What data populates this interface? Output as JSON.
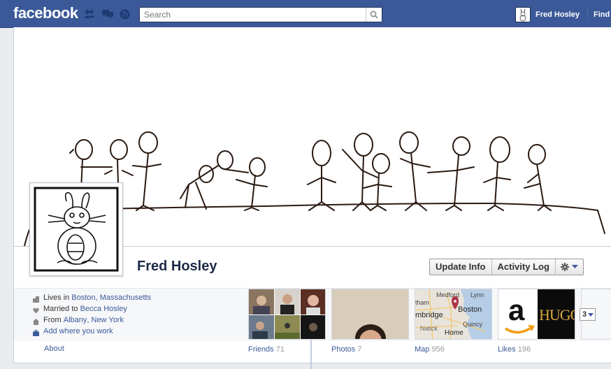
{
  "topbar": {
    "logo": "facebook",
    "search_placeholder": "Search",
    "user_name": "Fred Hosley",
    "find_label": "Find",
    "jewels": [
      "friend-requests-icon",
      "messages-icon",
      "notifications-globe-icon"
    ]
  },
  "profile": {
    "name": "Fred Hosley",
    "actions": {
      "update_info": "Update Info",
      "activity_log": "Activity Log"
    }
  },
  "about": {
    "lives_prefix": "Lives in",
    "lives_city": "Boston",
    "lives_sep": ",",
    "lives_state": "Massachusetts",
    "married_prefix": "Married to",
    "married_name": "Becca Hosley",
    "from_prefix": "From",
    "from_city": "Albany",
    "from_sep": ",",
    "from_state": "New York",
    "add_work": "Add where you work",
    "about_link": "About"
  },
  "boxes": {
    "friends": {
      "label": "Friends",
      "count": "71"
    },
    "photos": {
      "label": "Photos",
      "count": "7"
    },
    "map": {
      "label": "Map",
      "count": "956"
    },
    "likes": {
      "label": "Likes",
      "count": "196"
    },
    "map_places": [
      "Medford",
      "Lynn",
      "Boston",
      "mbridge",
      "Quincy",
      "Natick",
      "tham",
      "Home"
    ],
    "likes_tiles": [
      "a",
      "HUGO"
    ],
    "more_count": "3"
  },
  "colors": {
    "brand_blue": "#3b5998",
    "link_blue": "#3b5998",
    "name_dark": "#1c2a47"
  }
}
